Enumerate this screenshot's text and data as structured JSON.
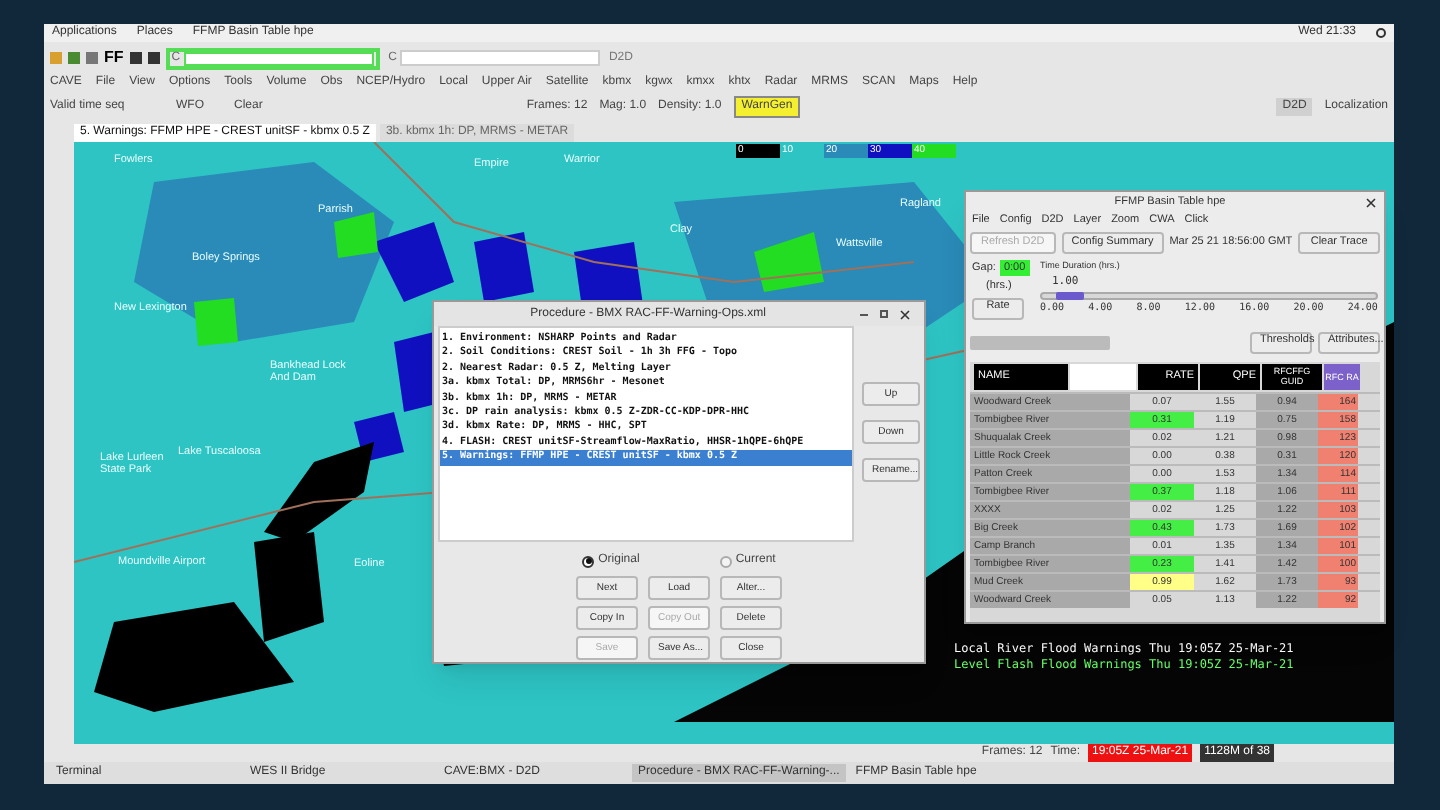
{
  "top_bar": {
    "menus": [
      "Applications",
      "Places",
      "FFMP Basin Table hpe"
    ],
    "clock": "Wed 21:33"
  },
  "toolbar_1": {
    "ff_label": "FF",
    "field_buttons": [
      "C",
      "C"
    ],
    "app_label": "D2D"
  },
  "menu_bar": [
    "CAVE",
    "File",
    "View",
    "Options",
    "Tools",
    "Volume",
    "Obs",
    "NCEP/Hydro",
    "Local",
    "Upper Air",
    "Satellite",
    "kbmx",
    "kgwx",
    "kmxx",
    "khtx",
    "Radar",
    "MRMS",
    "SCAN",
    "Maps",
    "Help"
  ],
  "toolbar_2": {
    "time_mode": "Valid time seq",
    "scale": "WFO",
    "clear": "Clear",
    "frames": "Frames: 12",
    "mag": "Mag: 1.0",
    "density": "Density: 1.0",
    "warngen": "WarnGen",
    "perspective": "D2D",
    "localization": "Localization"
  },
  "tabs": [
    {
      "label": "5. Warnings: FFMP HPE - CREST unitSF - kbmx 0.5 Z",
      "selected": true
    },
    {
      "label": "3b. kbmx 1h: DP, MRMS - METAR",
      "selected": false
    }
  ],
  "map": {
    "legend": [
      "0",
      "10",
      "20",
      "30",
      "40"
    ],
    "labels": [
      "Fowlers",
      "Empire",
      "Warrior",
      "Ragland",
      "Clay",
      "Wattsville",
      "Parrish",
      "Boley Springs",
      "New Lexington",
      "Bankhead Lock And Dam",
      "Lake Lurleen State Park",
      "Lake Tuscaloosa",
      "Moundville Airport",
      "Eoline"
    ],
    "warnings": [
      {
        "text": "Local River Flood Warnings  Thu 19:05Z 25-Mar-21",
        "color": "#ffffff"
      },
      {
        "text": "Level Flash Flood Warnings  Thu 19:05Z 25-Mar-21",
        "color": "#66ff66"
      }
    ]
  },
  "status_bar": {
    "frames": "Frames: 12",
    "time_label": "Time:",
    "time": "19:05Z 25-Mar-21",
    "memory": "1128M of 38"
  },
  "procedure": {
    "title": "Procedure - BMX RAC-FF-Warning-Ops.xml",
    "items": [
      {
        "text": "1. Environment: NSHARP Points and Radar",
        "selected": false
      },
      {
        "text": "2. Soil Conditions: CREST Soil - 1h 3h FFG - Topo",
        "selected": false
      },
      {
        "text": "2. Nearest Radar: 0.5 Z, Melting Layer",
        "selected": false
      },
      {
        "text": "3a. kbmx Total: DP, MRMS6hr - Mesonet",
        "selected": false
      },
      {
        "text": "3b. kbmx 1h: DP, MRMS - METAR",
        "selected": false
      },
      {
        "text": "3c. DP rain analysis: kbmx 0.5 Z-ZDR-CC-KDP-DPR-HHC",
        "selected": false
      },
      {
        "text": "3d. kbmx Rate: DP, MRMS - HHC, SPT",
        "selected": false
      },
      {
        "text": "4. FLASH: CREST unitSF-Streamflow-MaxRatio, HHSR-1hQPE-6hQPE",
        "selected": false
      },
      {
        "text": "5. Warnings: FFMP HPE - CREST unitSF - kbmx 0.5 Z",
        "selected": true
      }
    ],
    "side_buttons": [
      "Up",
      "Down",
      "Rename..."
    ],
    "radios": [
      {
        "label": "Original",
        "selected": true
      },
      {
        "label": "Current",
        "selected": false
      }
    ],
    "buttons": [
      {
        "label": "Next",
        "disabled": false
      },
      {
        "label": "Load",
        "disabled": false
      },
      {
        "label": "Alter...",
        "disabled": false
      },
      {
        "label": "Copy In",
        "disabled": false
      },
      {
        "label": "Copy Out",
        "disabled": true
      },
      {
        "label": "Delete",
        "disabled": false
      },
      {
        "label": "Save",
        "disabled": true
      },
      {
        "label": "Save As...",
        "disabled": false
      },
      {
        "label": "Close",
        "disabled": false
      }
    ]
  },
  "ffmp": {
    "title": "FFMP Basin Table hpe",
    "menus": [
      "File",
      "Config",
      "D2D",
      "Layer",
      "Zoom",
      "CWA",
      "Click"
    ],
    "refresh": {
      "label": "Refresh D2D",
      "disabled": true
    },
    "config_summary": "Config Summary",
    "timestamp": "Mar 25 21 18:56:00 GMT",
    "clear_trace": "Clear Trace",
    "gap_label": "Gap:",
    "gap_value": "0:00",
    "gap_unit": "(hrs.)",
    "rate_button": "Rate",
    "duration_label": "Time Duration (hrs.)",
    "duration_value": "1.00",
    "duration": {
      "level": 0.04
    },
    "ticks": [
      "0.00",
      "4.00",
      "8.00",
      "12.00",
      "16.00",
      "20.00",
      "24.00"
    ],
    "thresholds": "Thresholds",
    "attributes": "Attributes...",
    "columns": [
      "NAME",
      "RATE",
      "QPE",
      "RFCFFG GUID",
      "RFC RA"
    ],
    "rows": [
      {
        "name": "Woodward Creek",
        "rate": "0.07",
        "color": "#d8d8d8",
        "qpe": "1.55",
        "guid": "0.94",
        "ratio": "164"
      },
      {
        "name": "Tombigbee River",
        "rate": "0.31",
        "color": "#44ee44",
        "qpe": "1.19",
        "guid": "0.75",
        "ratio": "158"
      },
      {
        "name": "Shuqualak Creek",
        "rate": "0.02",
        "color": "#d8d8d8",
        "qpe": "1.21",
        "guid": "0.98",
        "ratio": "123"
      },
      {
        "name": "Little Rock Creek",
        "rate": "0.00",
        "color": "#d8d8d8",
        "qpe": "0.38",
        "guid": "0.31",
        "ratio": "120"
      },
      {
        "name": "Patton Creek",
        "rate": "0.00",
        "color": "#d8d8d8",
        "qpe": "1.53",
        "guid": "1.34",
        "ratio": "114"
      },
      {
        "name": "Tombigbee River",
        "rate": "0.37",
        "color": "#44ee44",
        "qpe": "1.18",
        "guid": "1.06",
        "ratio": "111"
      },
      {
        "name": "XXXX",
        "rate": "0.02",
        "color": "#d8d8d8",
        "qpe": "1.25",
        "guid": "1.22",
        "ratio": "103"
      },
      {
        "name": "Big Creek",
        "rate": "0.43",
        "color": "#44ee44",
        "qpe": "1.73",
        "guid": "1.69",
        "ratio": "102"
      },
      {
        "name": "Camp Branch",
        "rate": "0.01",
        "color": "#d8d8d8",
        "qpe": "1.35",
        "guid": "1.34",
        "ratio": "101"
      },
      {
        "name": "Tombigbee River",
        "rate": "0.23",
        "color": "#44ee44",
        "qpe": "1.41",
        "guid": "1.42",
        "ratio": "100"
      },
      {
        "name": "Mud Creek",
        "rate": "0.99",
        "color": "#ffff88",
        "qpe": "1.62",
        "guid": "1.73",
        "ratio": "93"
      },
      {
        "name": "Woodward Creek",
        "rate": "0.05",
        "color": "#d8d8d8",
        "qpe": "1.13",
        "guid": "1.22",
        "ratio": "92"
      }
    ]
  },
  "taskbar": [
    {
      "label": "Terminal",
      "selected": false
    },
    {
      "label": "WES II Bridge",
      "selected": false
    },
    {
      "label": "CAVE:BMX - D2D",
      "selected": false
    },
    {
      "label": "Procedure - BMX RAC-FF-Warning-...",
      "selected": true
    },
    {
      "label": "FFMP Basin Table hpe",
      "selected": false
    }
  ]
}
